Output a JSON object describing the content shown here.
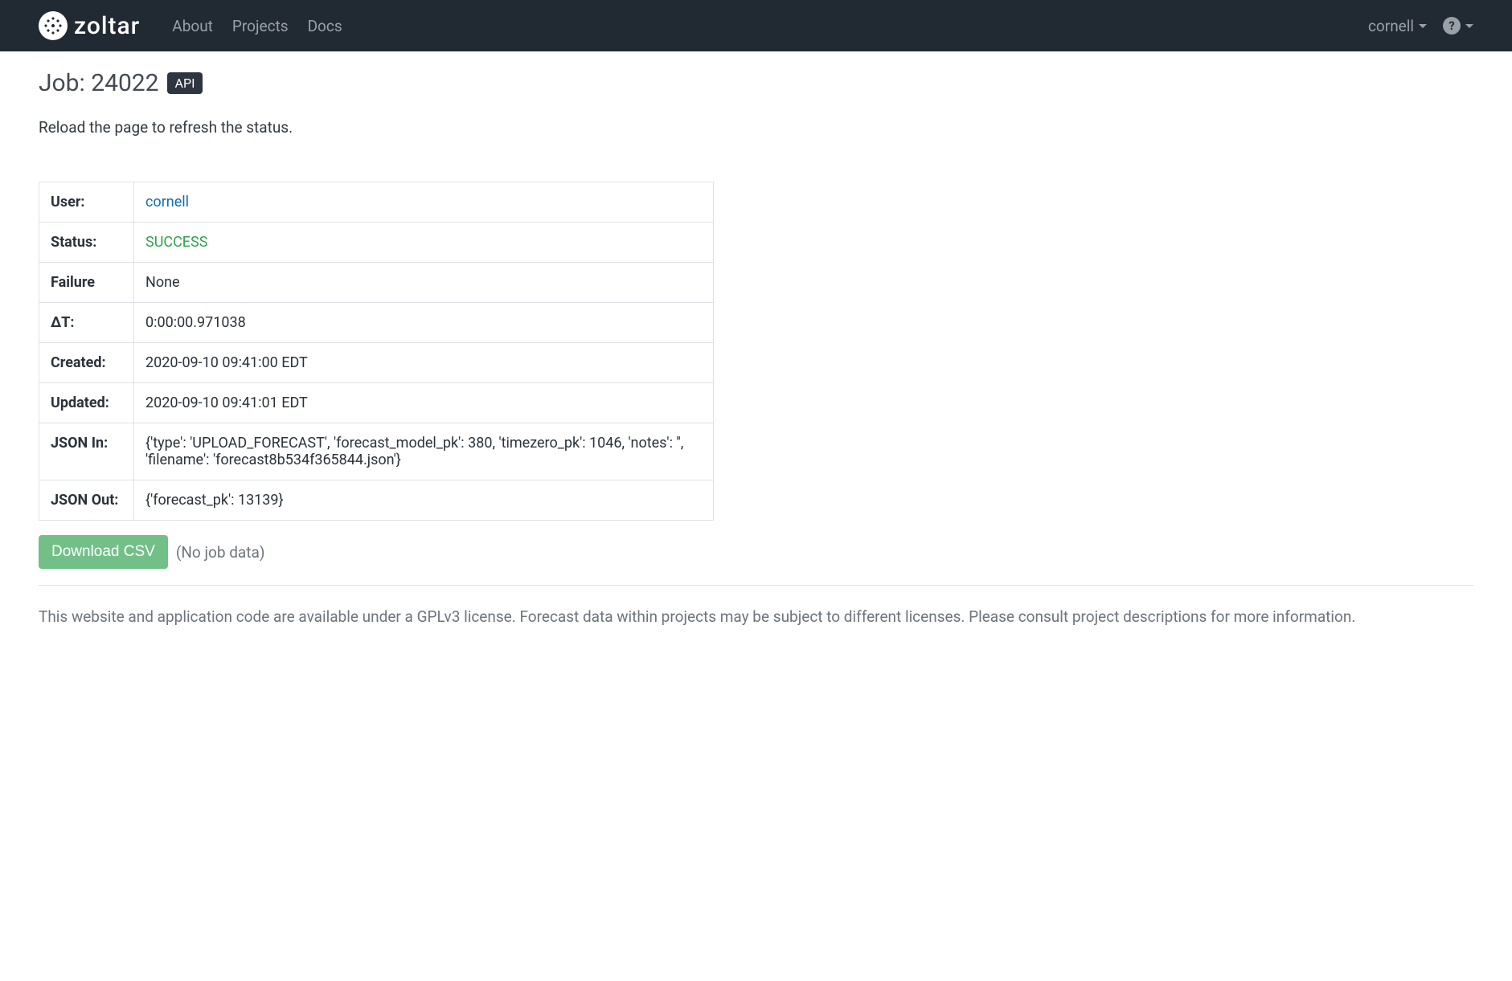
{
  "navbar": {
    "brand": "zoltar",
    "links": [
      "About",
      "Projects",
      "Docs"
    ],
    "user": "cornell"
  },
  "page": {
    "title_prefix": "Job: ",
    "job_id": "24022",
    "api_badge": "API",
    "subtitle": "Reload the page to refresh the status."
  },
  "table": {
    "rows": [
      {
        "label": "User:",
        "value": "cornell",
        "type": "link"
      },
      {
        "label": "Status:",
        "value": "SUCCESS",
        "type": "status"
      },
      {
        "label": "Failure",
        "value": "None",
        "type": "text"
      },
      {
        "label": "ΔT:",
        "value": "0:00:00.971038",
        "type": "text"
      },
      {
        "label": "Created:",
        "value": "2020-09-10 09:41:00 EDT",
        "type": "text"
      },
      {
        "label": "Updated:",
        "value": "2020-09-10 09:41:01 EDT",
        "type": "text"
      },
      {
        "label": "JSON In:",
        "value": "{'type': 'UPLOAD_FORECAST', 'forecast_model_pk': 380, 'timezero_pk': 1046, 'notes': '', 'filename': 'forecast8b534f365844.json'}",
        "type": "text"
      },
      {
        "label": "JSON Out:",
        "value": "{'forecast_pk': 13139}",
        "type": "text"
      }
    ]
  },
  "download": {
    "button_label": "Download CSV",
    "note": "(No job data)"
  },
  "footer": {
    "text": "This website and application code are available under a GPLv3 license. Forecast data within projects may be subject to different licenses. Please consult project descriptions for more information."
  }
}
